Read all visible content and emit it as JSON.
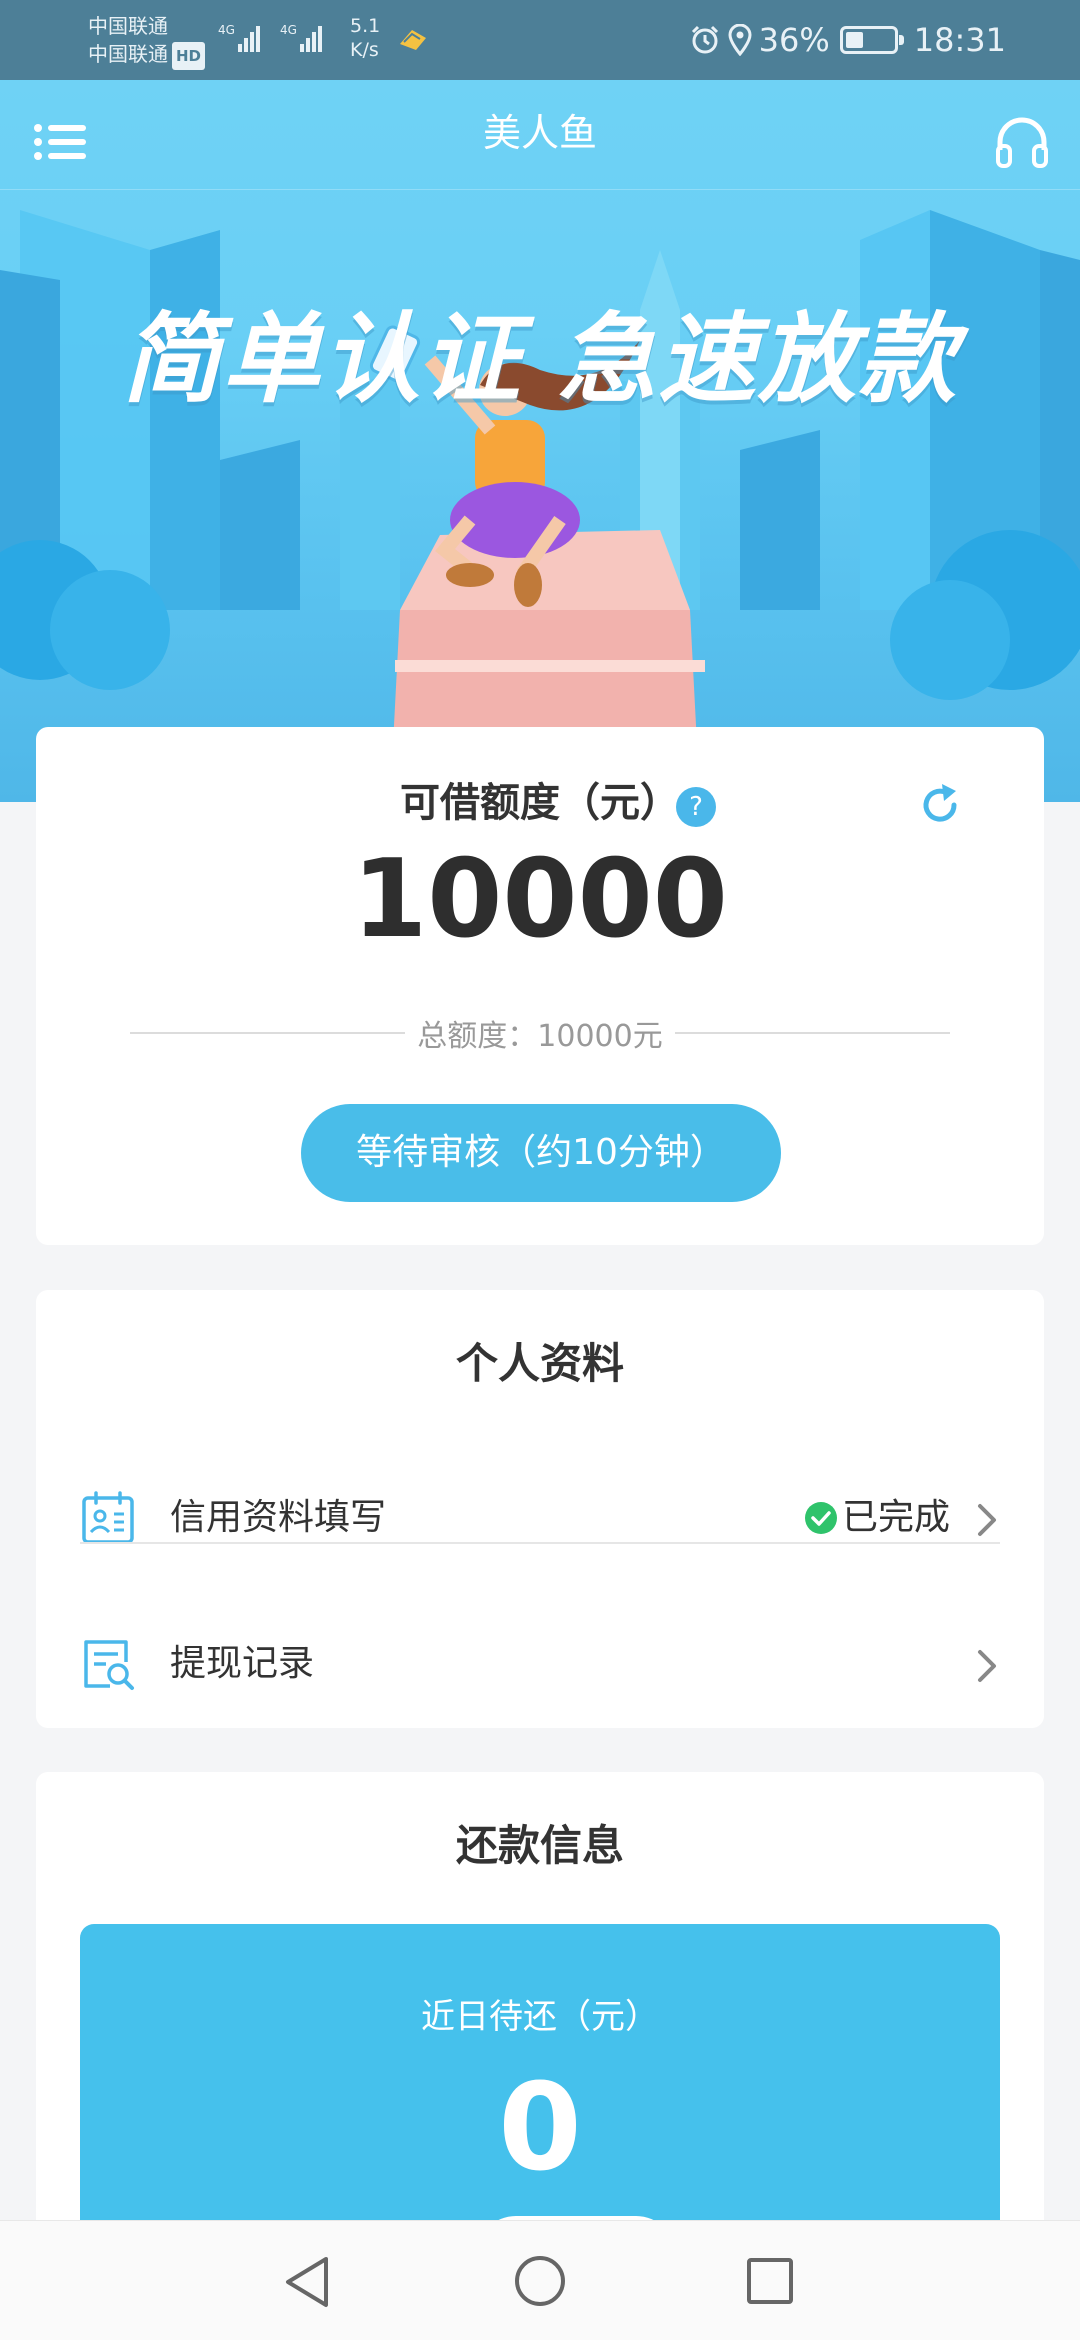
{
  "status_bar": {
    "carrier_1": "中国联通",
    "carrier_2": "中国联通",
    "hd_badge": "HD",
    "network_1": "4G",
    "network_2": "4G",
    "speed_value": "5.1",
    "speed_unit": "K/s",
    "battery_percent": "36%",
    "battery_level": 0.36,
    "time": "18:31",
    "icons": [
      "alarm-icon",
      "location-icon",
      "battery-icon"
    ]
  },
  "nav": {
    "title": "美人鱼",
    "left_icon": "menu-icon",
    "right_icon": "headset-icon"
  },
  "banner": {
    "slogan": "简单认证 急速放款"
  },
  "quota": {
    "label": "可借额度（元）",
    "help_glyph": "?",
    "value": "10000",
    "total_text": "总额度：10000元",
    "status_button": "等待审核（约10分钟）"
  },
  "profile": {
    "title": "个人资料",
    "items": [
      {
        "label": "信用资料填写",
        "status": "已完成",
        "icon": "id-card-calendar-icon"
      },
      {
        "label": "提现记录",
        "status": "",
        "icon": "search-document-icon"
      }
    ]
  },
  "repayment": {
    "title": "还款信息",
    "label": "近日待还（元）",
    "value": "0"
  },
  "colors": {
    "status_bar": "#4d7f97",
    "hero_top": "#6fd2f5",
    "accent": "#49bde9",
    "success": "#2fc36b",
    "text_primary": "#333333",
    "text_muted": "#999999"
  }
}
